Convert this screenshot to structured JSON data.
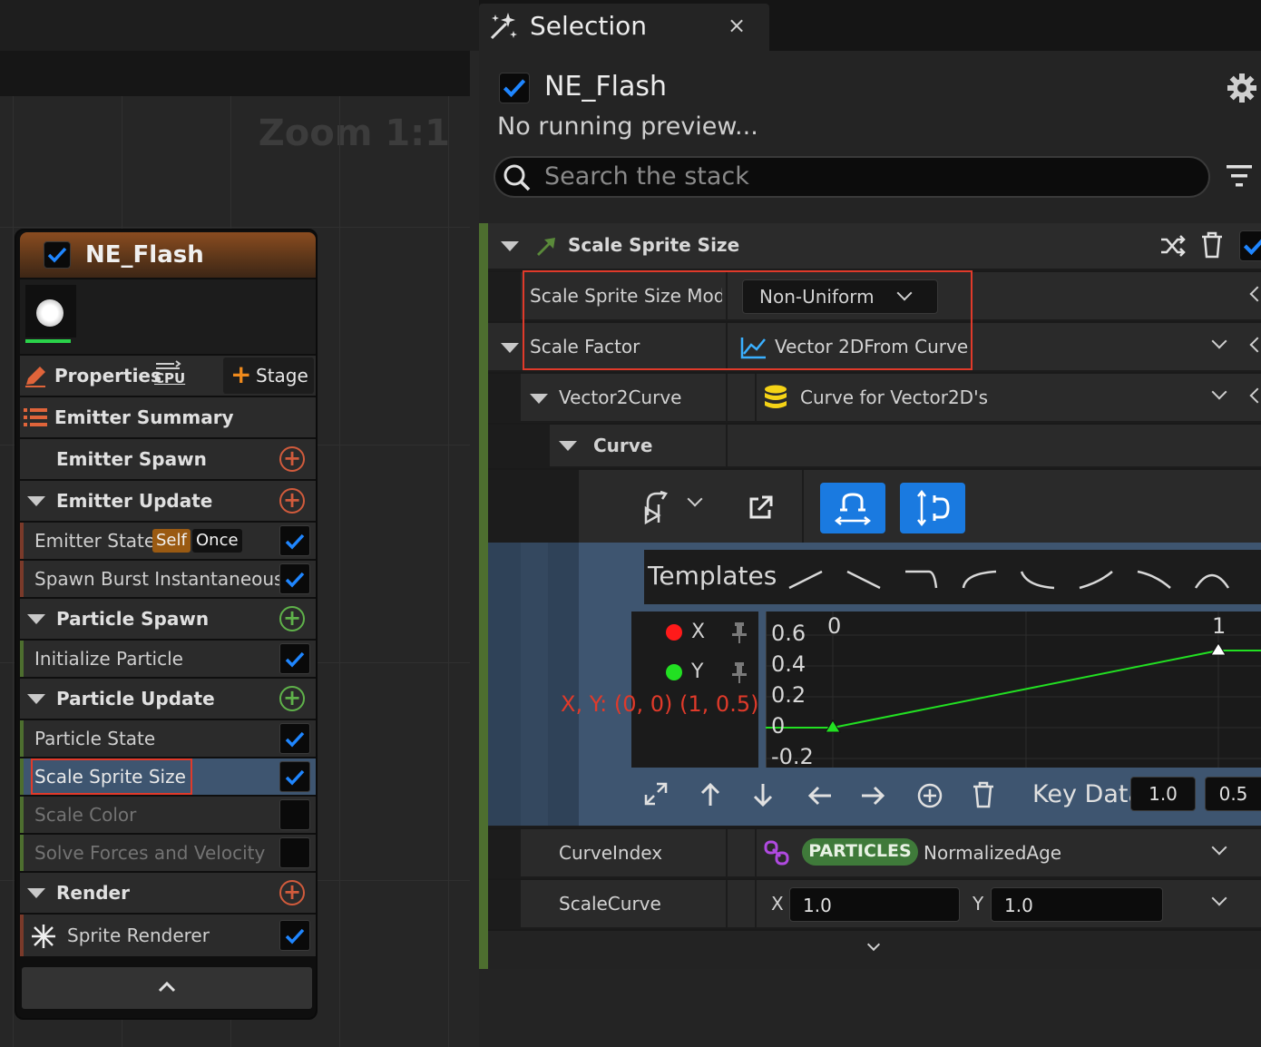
{
  "graph": {
    "zoom_label": "Zoom 1:1"
  },
  "node": {
    "title": "NE_Flash",
    "properties_label": "Properties",
    "cpu_label": "CPU",
    "stage_label": "Stage",
    "emitter_summary_label": "Emitter Summary",
    "emitter_spawn_label": "Emitter Spawn",
    "emitter_update_label": "Emitter Update",
    "emitter_state_label": "Emitter State",
    "self_tag": "Self",
    "once_tag": "Once",
    "spawn_burst_label": "Spawn Burst Instantaneous",
    "particle_spawn_label": "Particle Spawn",
    "initialize_particle_label": "Initialize Particle",
    "particle_update_label": "Particle Update",
    "particle_state_label": "Particle State",
    "scale_sprite_size_label": "Scale Sprite Size",
    "scale_color_label": "Scale Color",
    "solve_forces_label": "Solve Forces and Velocity",
    "render_label": "Render",
    "sprite_renderer_label": "Sprite Renderer"
  },
  "tab": {
    "title": "Selection",
    "close": "×"
  },
  "panel": {
    "emitter_name": "NE_Flash",
    "preview_status": "No running preview...",
    "search_placeholder": "Search the stack",
    "module_title": "Scale Sprite Size",
    "rows": {
      "mode_label": "Scale Sprite Size Mod​e",
      "mode_value": "Non-Uniform",
      "scale_factor_label": "Scale Factor",
      "scale_factor_value": "Vector 2DFrom Curve",
      "vector2curve_label": "Vector2Curve",
      "vector2curve_value": "Curve for Vector2D's",
      "curve_label": "Curve",
      "curveindex_label": "CurveIndex",
      "particles_pill": "PARTICLES",
      "normalized_age": "NormalizedAge",
      "scalecurve_label": "ScaleCurve",
      "x_label": "X",
      "x_value": "1.0",
      "y_label": "Y",
      "y_value": "1.0"
    },
    "curve_editor": {
      "templates_label": "Templates",
      "legend": [
        {
          "name": "X",
          "color": "#ff1a1a"
        },
        {
          "name": "Y",
          "color": "#22e022"
        }
      ],
      "y_ticks": [
        "0.6",
        "0.4",
        "0.2",
        "0",
        "-0.2"
      ],
      "x_ticks": [
        "0",
        "1"
      ],
      "annotation": "X, Y: (0, 0) (1, 0.5)",
      "key_data_label": "Key Data",
      "key_time": "1.0",
      "key_value": "0.5",
      "keys": [
        {
          "time": 0,
          "value": 0
        },
        {
          "time": 1,
          "value": 0.5
        }
      ]
    }
  },
  "colors": {
    "accent_blue": "#1a7ae0",
    "curve_green": "#22e022",
    "highlight_red": "#e03a2a"
  }
}
